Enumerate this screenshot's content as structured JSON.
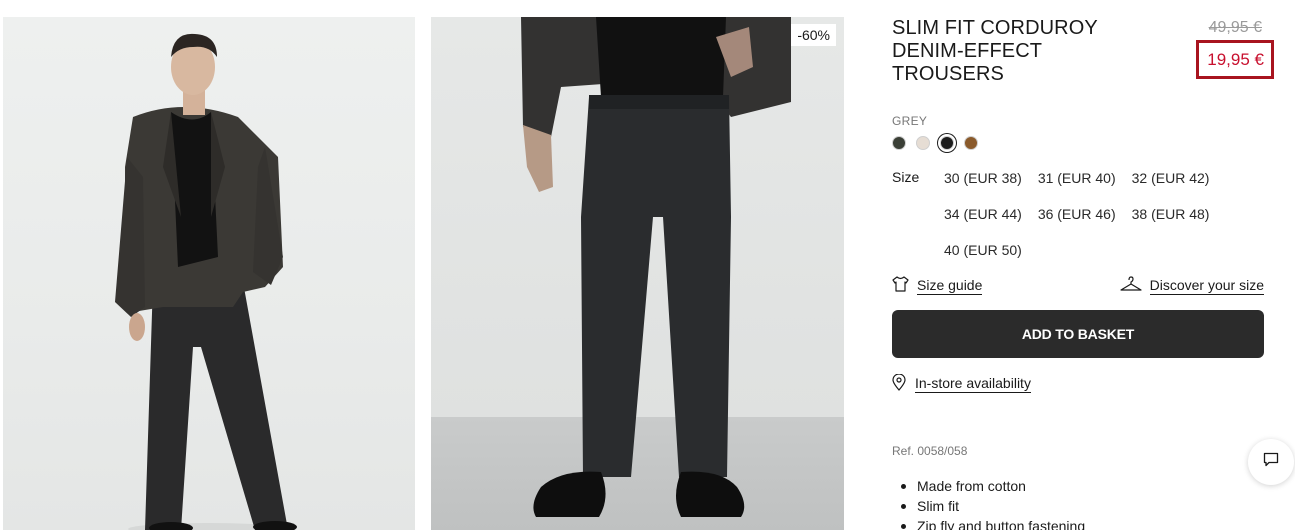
{
  "product": {
    "title": "SLIM FIT CORDUROY DENIM-EFFECT TROUSERS",
    "old_price": "49,95 €",
    "new_price": "19,95 €",
    "discount_badge": "-60%",
    "color_label": "GREY",
    "swatches": [
      {
        "name": "dark-olive",
        "color": "#3a3f36"
      },
      {
        "name": "cream",
        "color": "#e6ddd4"
      },
      {
        "name": "black",
        "color": "#1c1c1c"
      },
      {
        "name": "brown",
        "color": "#8a5a2b"
      }
    ],
    "size_label": "Size",
    "sizes": [
      "30 (EUR 38)",
      "31 (EUR 40)",
      "32 (EUR 42)",
      "34 (EUR 44)",
      "36 (EUR 46)",
      "38 (EUR 48)",
      "40 (EUR 50)"
    ],
    "size_guide_label": "Size guide",
    "discover_size_label": "Discover your size",
    "add_to_basket_label": "ADD TO BASKET",
    "in_store_label": "In-store availability",
    "ref": "Ref. 0058/058",
    "features": [
      "Made from cotton",
      "Slim fit",
      "Zip fly and button fastening"
    ]
  },
  "colors": {
    "accent_price": "#c8102e",
    "button_bg": "#2b2b2b"
  },
  "icons": {
    "size_guide": "tshirt-icon",
    "discover_size": "hanger-icon",
    "in_store": "location-pin-icon",
    "chat": "chat-bubble-icon"
  }
}
